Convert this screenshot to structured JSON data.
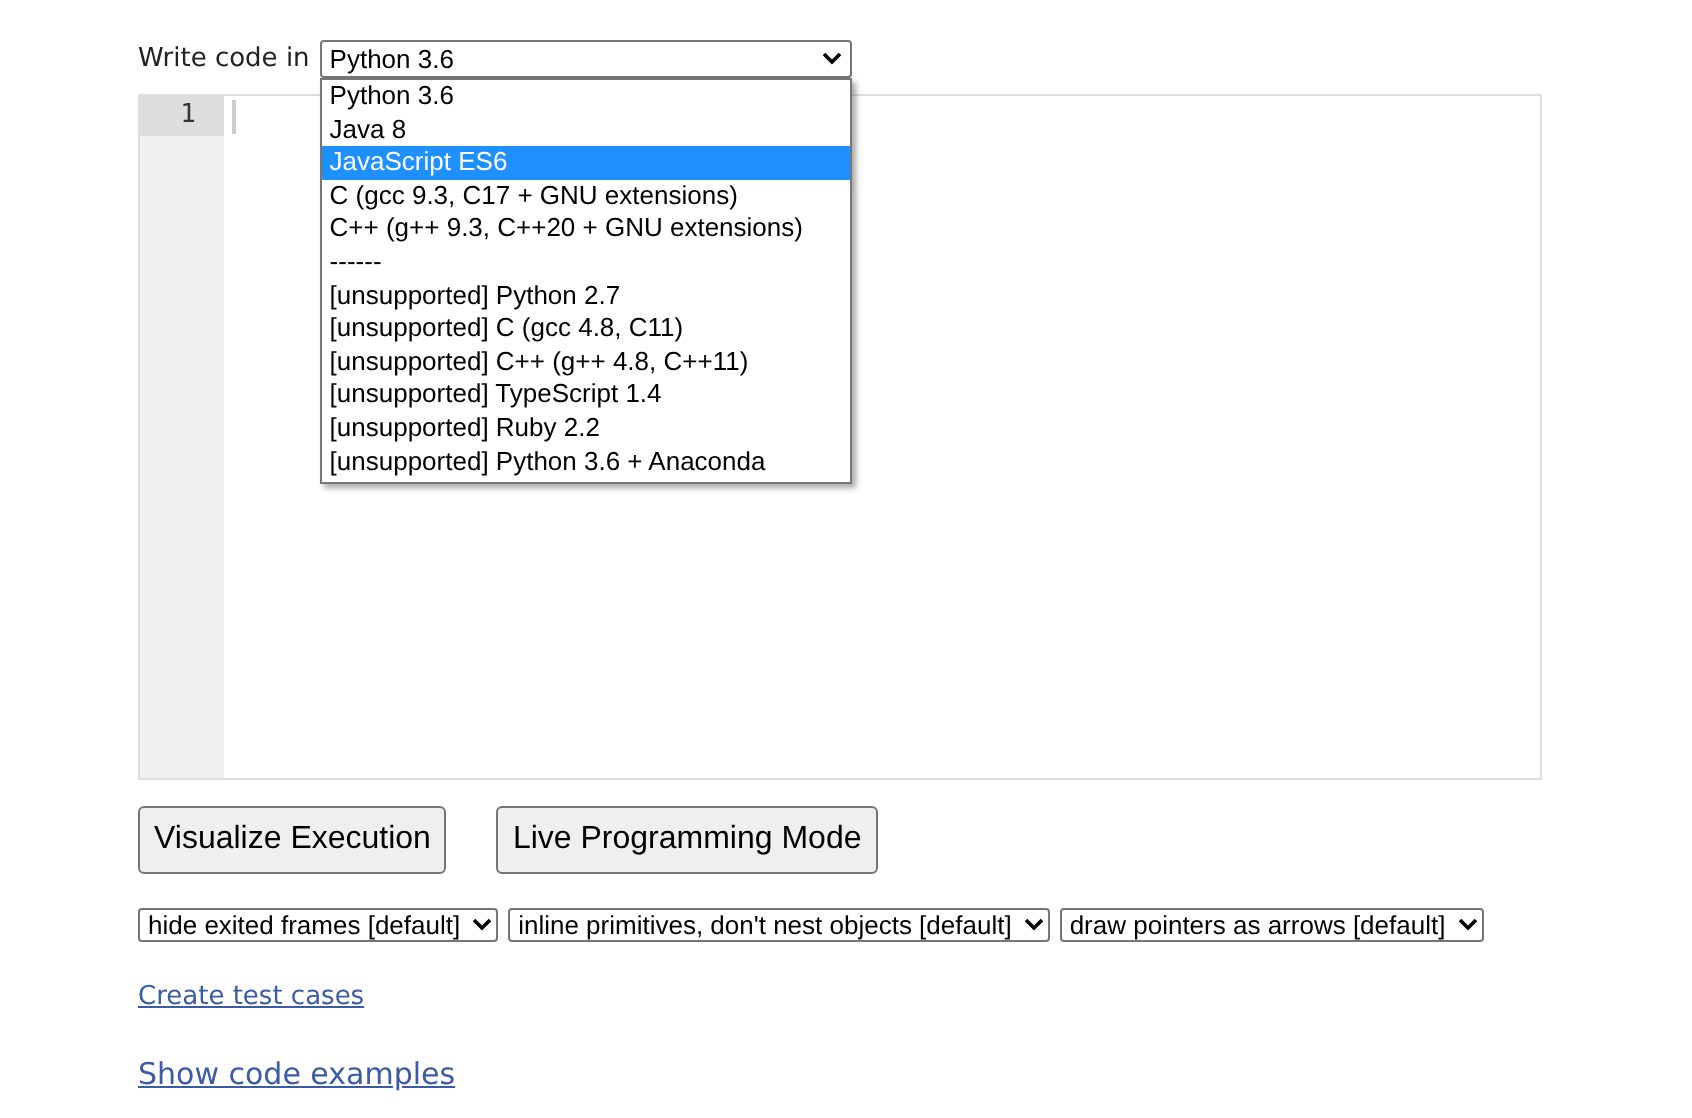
{
  "language_picker": {
    "label": "Write code in",
    "value": "Python 3.6",
    "expanded": true,
    "options": [
      {
        "label": "Python 3.6",
        "highlighted": false
      },
      {
        "label": "Java 8",
        "highlighted": false
      },
      {
        "label": "JavaScript ES6",
        "highlighted": true
      },
      {
        "label": "C (gcc 9.3, C17 + GNU extensions)",
        "highlighted": false
      },
      {
        "label": "C++ (g++ 9.3, C++20 + GNU extensions)",
        "highlighted": false
      },
      {
        "label": "------",
        "highlighted": false
      },
      {
        "label": "[unsupported] Python 2.7",
        "highlighted": false
      },
      {
        "label": "[unsupported] C (gcc 4.8, C11)",
        "highlighted": false
      },
      {
        "label": "[unsupported] C++ (g++ 4.8, C++11)",
        "highlighted": false
      },
      {
        "label": "[unsupported] TypeScript 1.4",
        "highlighted": false
      },
      {
        "label": "[unsupported] Ruby 2.2",
        "highlighted": false
      },
      {
        "label": "[unsupported] Python 3.6 + Anaconda",
        "highlighted": false
      }
    ]
  },
  "editor": {
    "line_numbers": [
      "1"
    ]
  },
  "buttons": [
    "Visualize Execution",
    "Live Programming Mode"
  ],
  "options": [
    "hide exited frames [default]",
    "inline primitives, don't nest objects [default]",
    "draw pointers as arrows [default]"
  ],
  "links": [
    "Create test cases",
    "Show code examples"
  ]
}
